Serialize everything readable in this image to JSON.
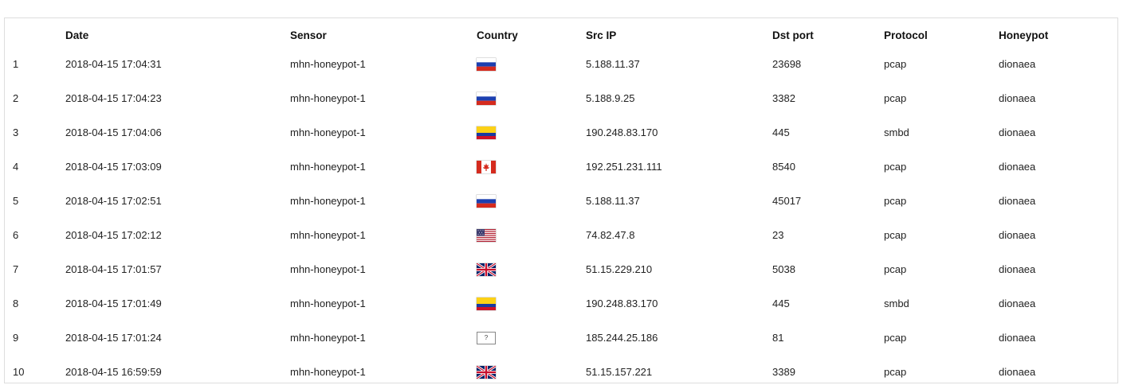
{
  "table": {
    "headers": {
      "index": "",
      "date": "Date",
      "sensor": "Sensor",
      "country": "Country",
      "src_ip": "Src IP",
      "dst_port": "Dst port",
      "protocol": "Protocol",
      "honeypot": "Honeypot"
    },
    "rows": [
      {
        "index": "1",
        "date": "2018-04-15 17:04:31",
        "sensor": "mhn-honeypot-1",
        "country_flag": "flag-russia-icon",
        "src_ip": "5.188.11.37",
        "dst_port": "23698",
        "protocol": "pcap",
        "honeypot": "dionaea"
      },
      {
        "index": "2",
        "date": "2018-04-15 17:04:23",
        "sensor": "mhn-honeypot-1",
        "country_flag": "flag-russia-icon",
        "src_ip": "5.188.9.25",
        "dst_port": "3382",
        "protocol": "pcap",
        "honeypot": "dionaea"
      },
      {
        "index": "3",
        "date": "2018-04-15 17:04:06",
        "sensor": "mhn-honeypot-1",
        "country_flag": "flag-colombia-icon",
        "src_ip": "190.248.83.170",
        "dst_port": "445",
        "protocol": "smbd",
        "honeypot": "dionaea"
      },
      {
        "index": "4",
        "date": "2018-04-15 17:03:09",
        "sensor": "mhn-honeypot-1",
        "country_flag": "flag-canada-icon",
        "src_ip": "192.251.231.111",
        "dst_port": "8540",
        "protocol": "pcap",
        "honeypot": "dionaea"
      },
      {
        "index": "5",
        "date": "2018-04-15 17:02:51",
        "sensor": "mhn-honeypot-1",
        "country_flag": "flag-russia-icon",
        "src_ip": "5.188.11.37",
        "dst_port": "45017",
        "protocol": "pcap",
        "honeypot": "dionaea"
      },
      {
        "index": "6",
        "date": "2018-04-15 17:02:12",
        "sensor": "mhn-honeypot-1",
        "country_flag": "flag-usa-icon",
        "src_ip": "74.82.47.8",
        "dst_port": "23",
        "protocol": "pcap",
        "honeypot": "dionaea"
      },
      {
        "index": "7",
        "date": "2018-04-15 17:01:57",
        "sensor": "mhn-honeypot-1",
        "country_flag": "flag-uk-icon",
        "src_ip": "51.15.229.210",
        "dst_port": "5038",
        "protocol": "pcap",
        "honeypot": "dionaea"
      },
      {
        "index": "8",
        "date": "2018-04-15 17:01:49",
        "sensor": "mhn-honeypot-1",
        "country_flag": "flag-colombia-icon",
        "src_ip": "190.248.83.170",
        "dst_port": "445",
        "protocol": "smbd",
        "honeypot": "dionaea"
      },
      {
        "index": "9",
        "date": "2018-04-15 17:01:24",
        "sensor": "mhn-honeypot-1",
        "country_flag": "flag-unknown-icon",
        "country_unknown_text": "?",
        "src_ip": "185.244.25.186",
        "dst_port": "81",
        "protocol": "pcap",
        "honeypot": "dionaea"
      },
      {
        "index": "10",
        "date": "2018-04-15 16:59:59",
        "sensor": "mhn-honeypot-1",
        "country_flag": "flag-uk-icon",
        "src_ip": "51.15.157.221",
        "dst_port": "3389",
        "protocol": "pcap",
        "honeypot": "dionaea"
      }
    ]
  }
}
